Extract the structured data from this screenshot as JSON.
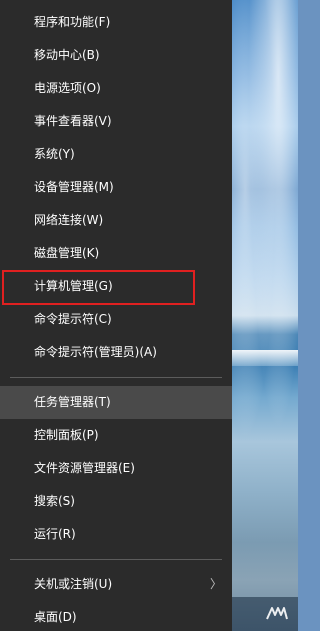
{
  "menu": {
    "group1": [
      {
        "label": "程序和功能(F)"
      },
      {
        "label": "移动中心(B)"
      },
      {
        "label": "电源选项(O)"
      },
      {
        "label": "事件查看器(V)"
      },
      {
        "label": "系统(Y)"
      },
      {
        "label": "设备管理器(M)"
      },
      {
        "label": "网络连接(W)"
      },
      {
        "label": "磁盘管理(K)"
      },
      {
        "label": "计算机管理(G)"
      },
      {
        "label": "命令提示符(C)"
      },
      {
        "label": "命令提示符(管理员)(A)"
      }
    ],
    "group2": [
      {
        "label": "任务管理器(T)"
      },
      {
        "label": "控制面板(P)"
      },
      {
        "label": "文件资源管理器(E)"
      },
      {
        "label": "搜索(S)"
      },
      {
        "label": "运行(R)"
      }
    ],
    "group3": [
      {
        "label": "关机或注销(U)",
        "submenu_arrow": "〉"
      },
      {
        "label": "桌面(D)"
      }
    ]
  },
  "colors": {
    "menu_background": "#2b2b2b",
    "menu_text": "#ffffff",
    "hover_background": "#4a4a4a",
    "annotation_border": "#e02020"
  },
  "icons": {
    "submenu_arrow": "chevron-right-icon",
    "taskbar_logo": "app-logo-icon"
  }
}
